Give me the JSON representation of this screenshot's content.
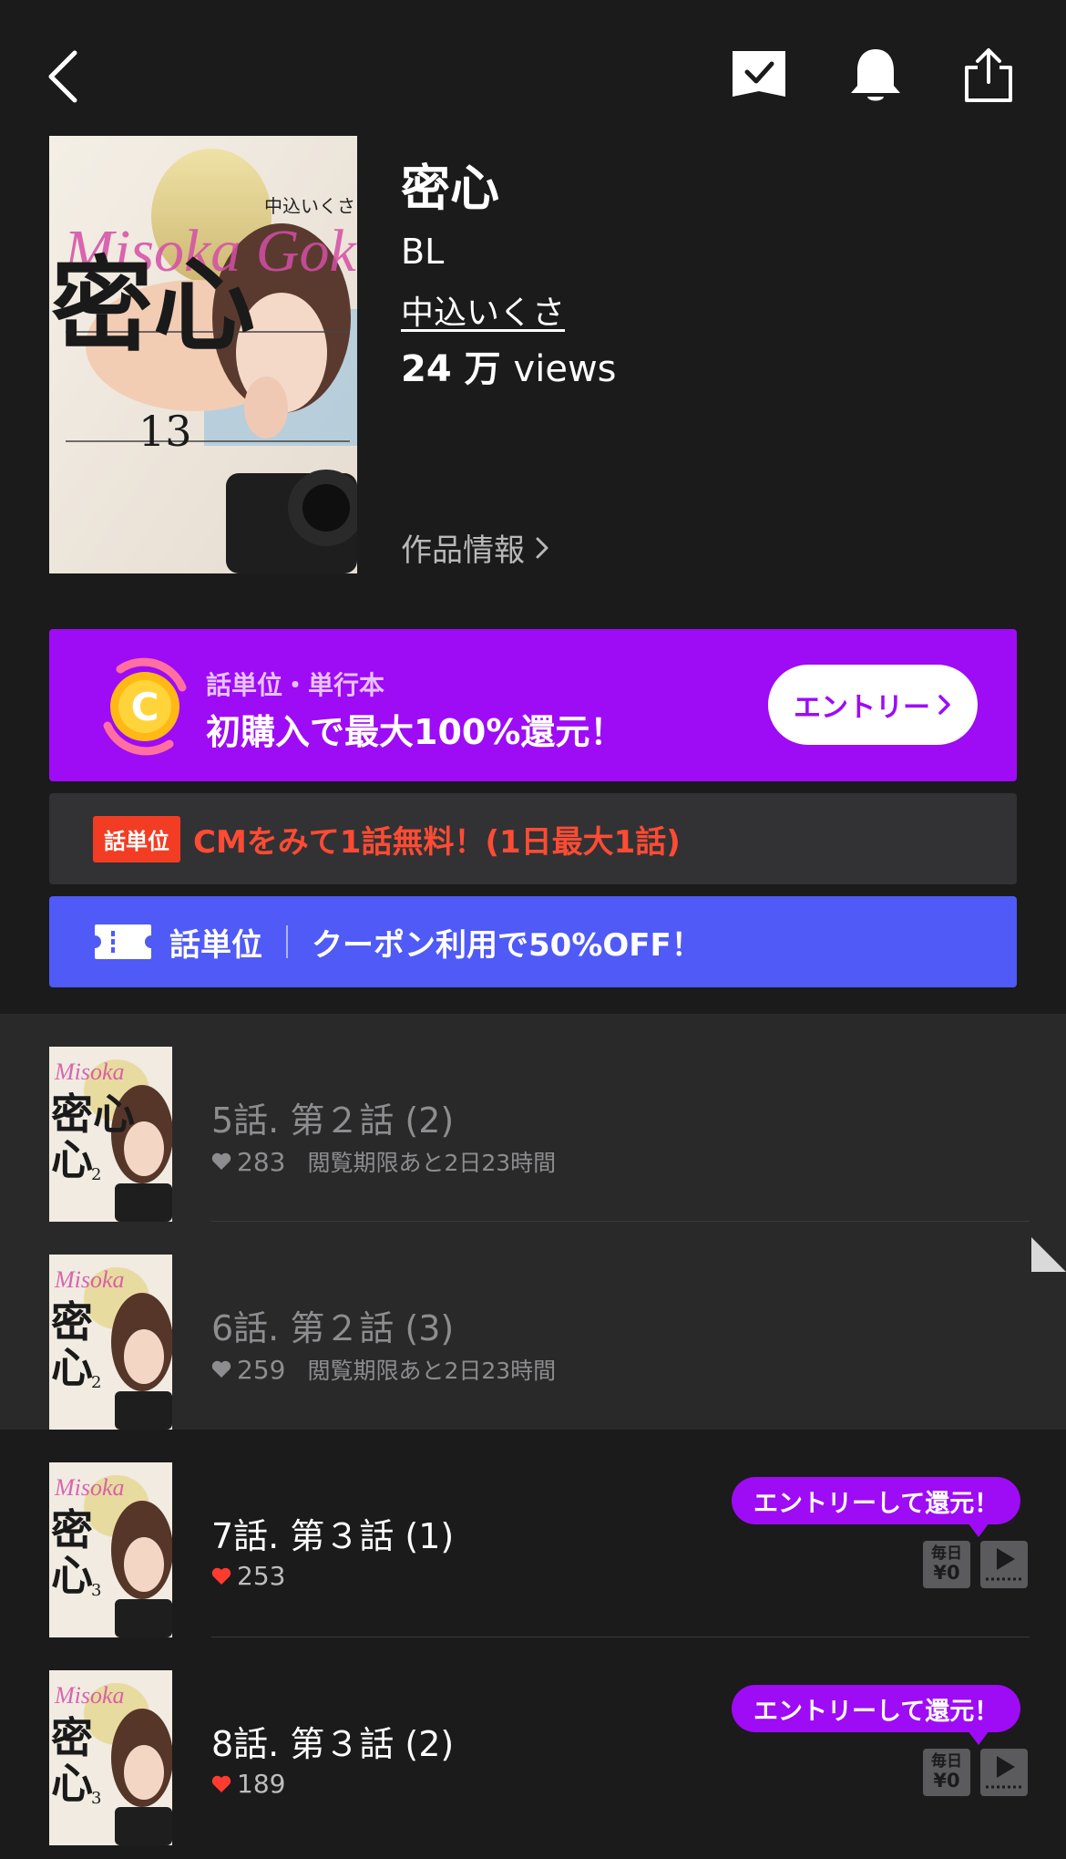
{
  "nav": {
    "back_icon": "chevron-left-icon",
    "bookmark_icon": "bookmark-check-icon",
    "bell_icon": "bell-icon",
    "share_icon": "share-icon"
  },
  "work": {
    "title": "密心",
    "genre": "BL",
    "author": "中込いくさ",
    "views_count": "24",
    "views_unit": "万",
    "views_label": "views",
    "info_link": "作品情報",
    "cover_text": "密心",
    "cover_volume": "13",
    "cover_script": "Misoka Gokoro",
    "cover_author": "中込いくさ"
  },
  "promo_banner": {
    "subtitle": "話単位・単行本",
    "headline": "初購入で最大100%還元！",
    "coin_letter": "C",
    "button_label": "エントリー",
    "bg_color": "#9e0bf5"
  },
  "cm_banner": {
    "badge": "話単位",
    "text": "CMをみて1話無料！(1日最大1話)",
    "text_color": "#ff4b33"
  },
  "coupon_banner": {
    "unit_label": "話単位",
    "text": "クーポン利用で50%OFF！",
    "bg_color": "#4f5af7"
  },
  "episodes": [
    {
      "title": "5話. 第２話 (2)",
      "likes": "283",
      "expiry": "閲覧期限あと2日23時間",
      "thumb_vol": "2",
      "state": "read"
    },
    {
      "title": "6話. 第２話 (3)",
      "likes": "259",
      "expiry": "閲覧期限あと2日23時間",
      "thumb_vol": "2",
      "state": "read"
    },
    {
      "title": "7話. 第３話 (1)",
      "likes": "253",
      "thumb_vol": "3",
      "state": "unread",
      "bubble": "エントリーして還元！",
      "daily_top": "毎日",
      "daily_bottom": "¥0"
    },
    {
      "title": "8話. 第３話 (2)",
      "likes": "189",
      "thumb_vol": "3",
      "state": "unread",
      "bubble": "エントリーして還元！",
      "daily_top": "毎日",
      "daily_bottom": "¥0"
    }
  ],
  "colors": {
    "background": "#1b1b1c",
    "read_row": "#29292a",
    "heart_read": "#8d8d8f",
    "heart_unread": "#ff3b30"
  }
}
